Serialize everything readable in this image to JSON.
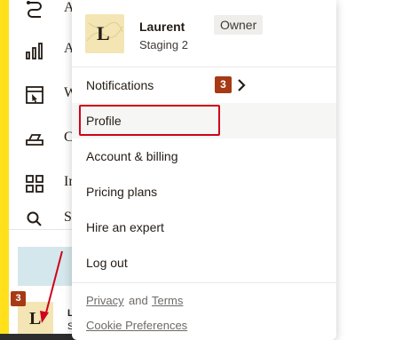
{
  "sidebar": {
    "items": [
      {
        "label": "A",
        "icon": "route-icon"
      },
      {
        "label": "A",
        "icon": "analytics-icon"
      },
      {
        "label": "W",
        "icon": "website-icon"
      },
      {
        "label": "C",
        "icon": "content-icon"
      },
      {
        "label": "In",
        "icon": "integrations-icon"
      },
      {
        "label": "S",
        "icon": "search-icon"
      }
    ],
    "notification_count": "3",
    "avatar_letter": "L",
    "user_initial_name": "L",
    "user_initial_sub": "S"
  },
  "menu": {
    "avatar_letter": "L",
    "user_name": "Laurent",
    "role": "Owner",
    "org": "Staging 2",
    "items": [
      {
        "label": "Notifications"
      },
      {
        "label": "Profile"
      },
      {
        "label": "Account & billing"
      },
      {
        "label": "Pricing plans"
      },
      {
        "label": "Hire an expert"
      },
      {
        "label": "Log out"
      }
    ],
    "notification_badge": "3",
    "footer": {
      "privacy": "Privacy",
      "and": "and",
      "terms": "Terms",
      "cookie": "Cookie Preferences"
    }
  },
  "colors": {
    "brand_yellow": "#ffe01b",
    "badge": "#a63a14",
    "highlight": "#d0021b"
  }
}
